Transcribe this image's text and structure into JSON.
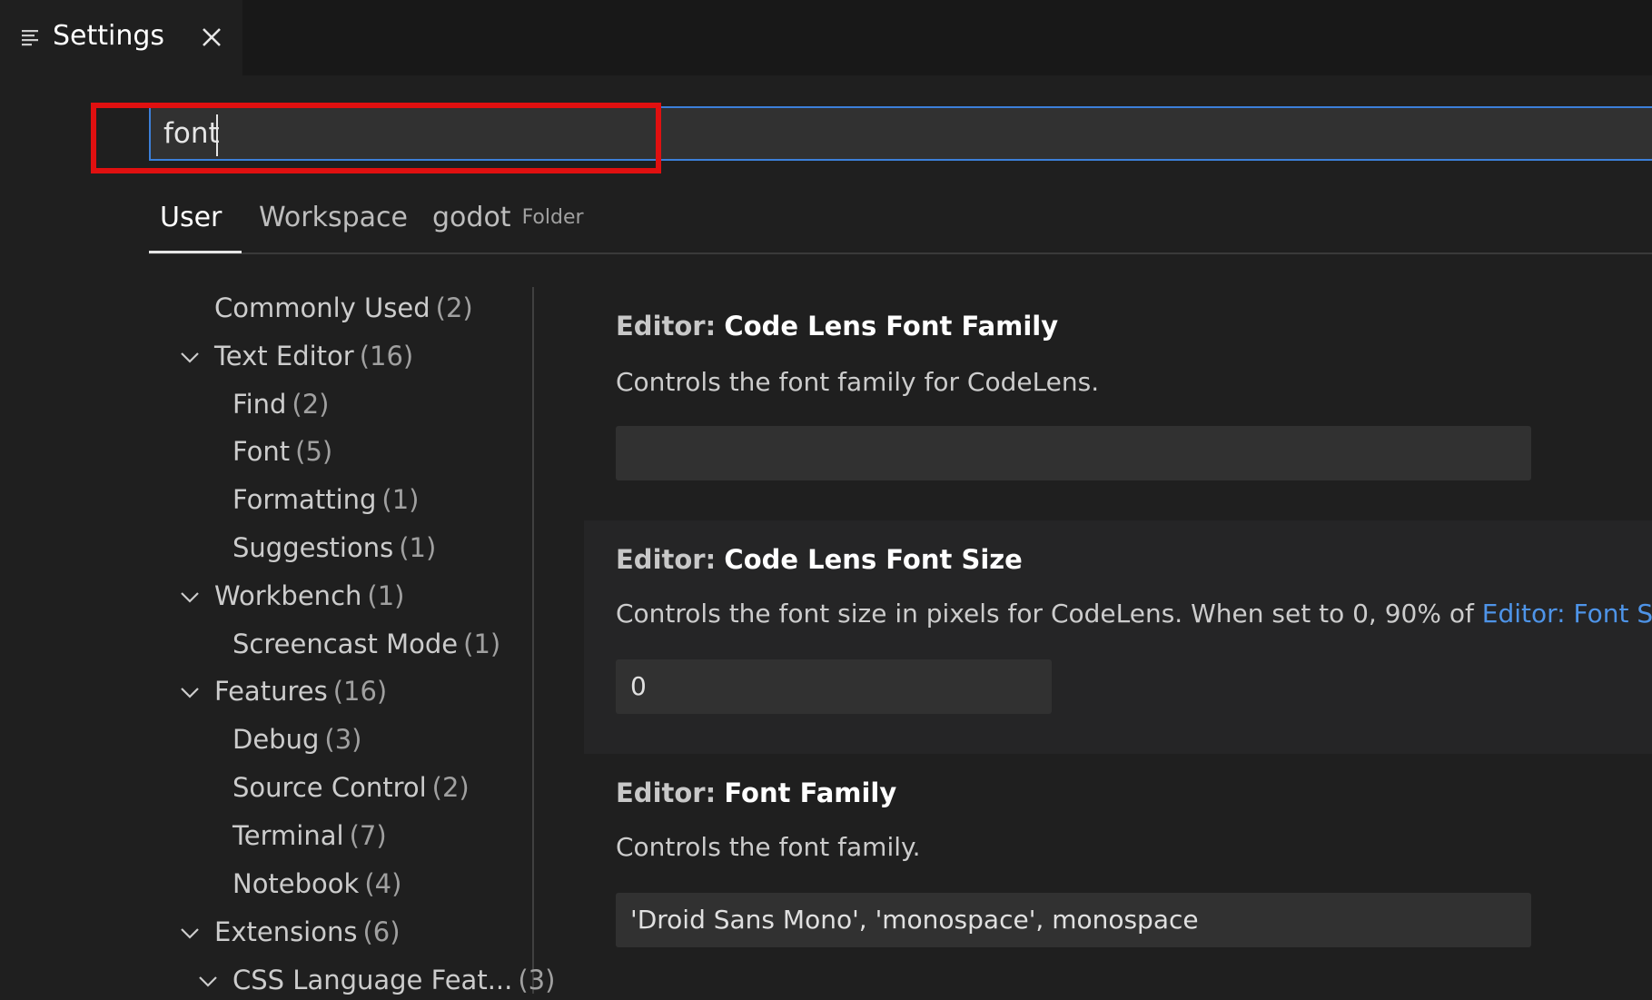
{
  "tab": {
    "label": "Settings"
  },
  "search": {
    "value": "font",
    "placeholder": ""
  },
  "scope_tabs": [
    {
      "label": "User",
      "active": true
    },
    {
      "label": "Workspace"
    },
    {
      "label": "godot",
      "sub": "Folder"
    }
  ],
  "toc": [
    {
      "label": "Commonly Used",
      "count": "(2)"
    },
    {
      "label": "Text Editor",
      "count": "(16)"
    },
    {
      "label": "Find",
      "count": "(2)"
    },
    {
      "label": "Font",
      "count": "(5)"
    },
    {
      "label": "Formatting",
      "count": "(1)"
    },
    {
      "label": "Suggestions",
      "count": "(1)"
    },
    {
      "label": "Workbench",
      "count": "(1)"
    },
    {
      "label": "Screencast Mode",
      "count": "(1)"
    },
    {
      "label": "Features",
      "count": "(16)"
    },
    {
      "label": "Debug",
      "count": "(3)"
    },
    {
      "label": "Source Control",
      "count": "(2)"
    },
    {
      "label": "Terminal",
      "count": "(7)"
    },
    {
      "label": "Notebook",
      "count": "(4)"
    },
    {
      "label": "Extensions",
      "count": "(6)"
    },
    {
      "label": "CSS Language Feat...",
      "count": "(3)"
    }
  ],
  "settings": [
    {
      "category": "Editor:",
      "name": "Code Lens Font Family",
      "description": "Controls the font family for CodeLens.",
      "value": ""
    },
    {
      "category": "Editor:",
      "name": "Code Lens Font Size",
      "description": "Controls the font size in pixels for CodeLens. When set to 0, 90% of ",
      "description_link": "Editor: Font Si",
      "value": "0"
    },
    {
      "category": "Editor:",
      "name": "Font Family",
      "description": "Controls the font family.",
      "value": "'Droid Sans Mono', 'monospace', monospace"
    }
  ],
  "colors": {
    "background": "#1f1f1f",
    "accent": "#3c7fd9",
    "highlight": "#e01010",
    "link": "#4e94e8"
  }
}
